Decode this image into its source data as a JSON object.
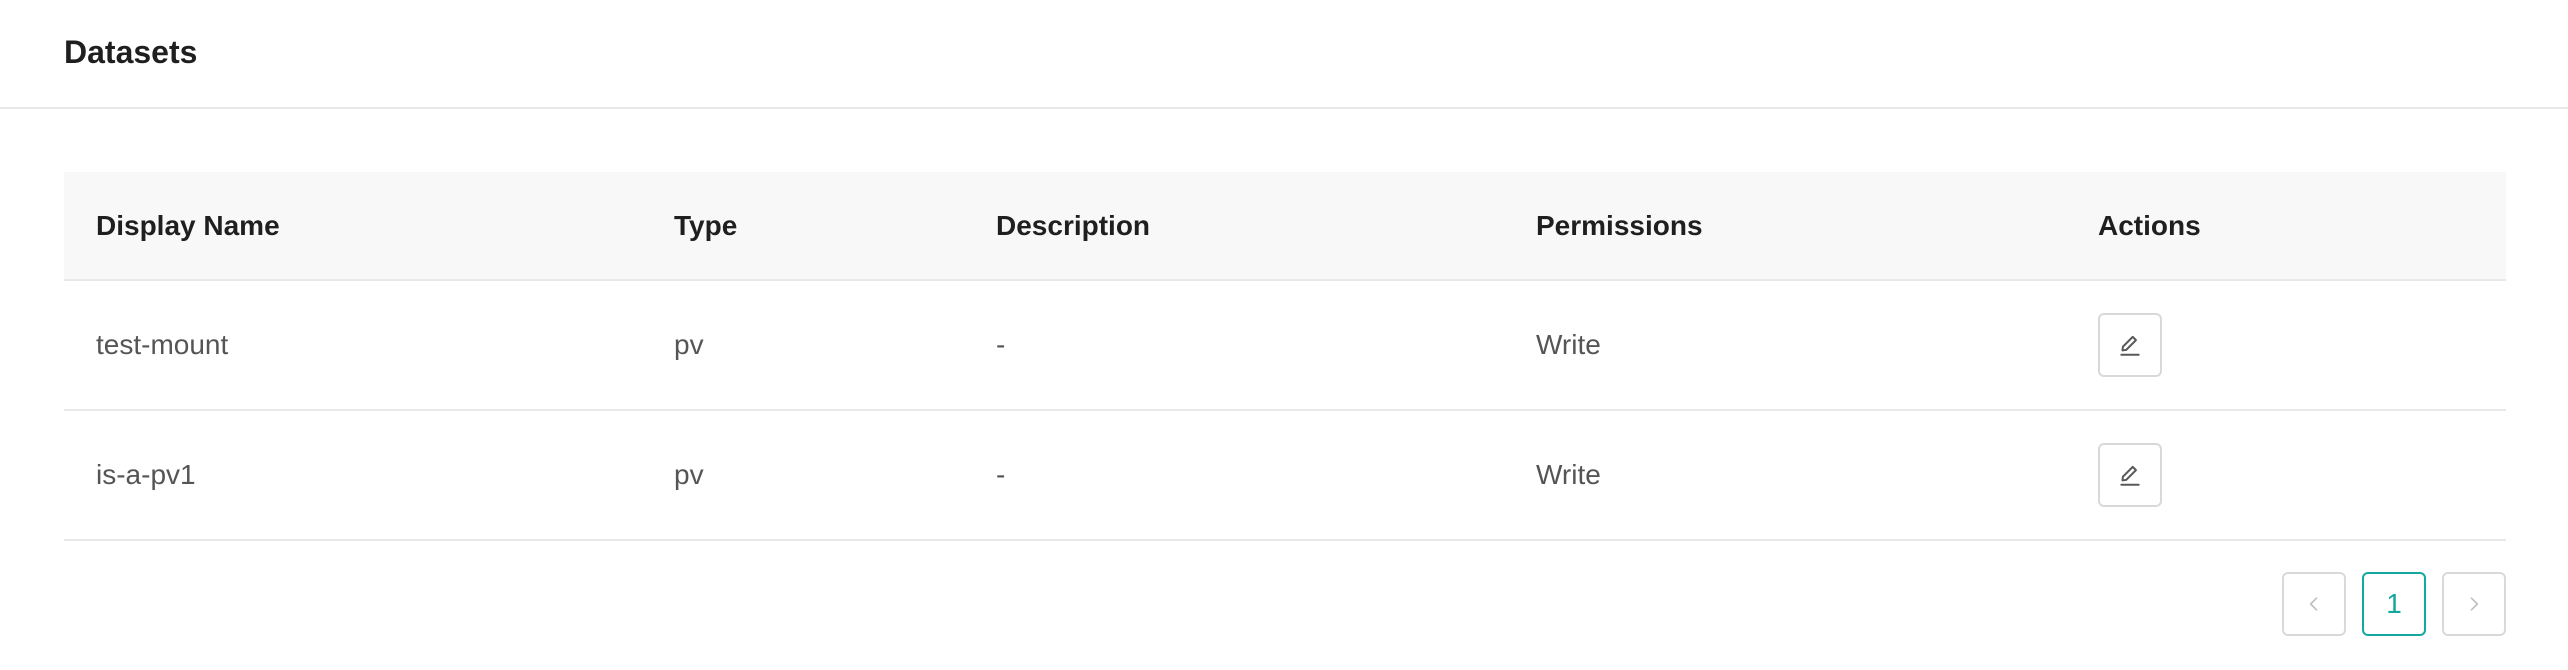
{
  "header": {
    "title": "Datasets"
  },
  "table": {
    "columns": [
      "Display Name",
      "Type",
      "Description",
      "Permissions",
      "Actions"
    ],
    "rows": [
      {
        "display_name": "test-mount",
        "type": "pv",
        "description": "-",
        "permissions": "Write",
        "action_icon": "edit-icon"
      },
      {
        "display_name": "is-a-pv1",
        "type": "pv",
        "description": "-",
        "permissions": "Write",
        "action_icon": "edit-icon"
      }
    ]
  },
  "pagination": {
    "prev_icon": "chevron-left-icon",
    "current_page": "1",
    "next_icon": "chevron-right-icon"
  },
  "colors": {
    "accent": "#13a89e",
    "border": "#d9d9d9",
    "header_bg": "#f8f8f8"
  }
}
